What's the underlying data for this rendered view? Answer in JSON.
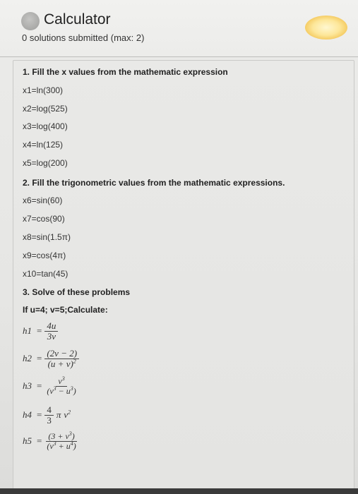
{
  "header": {
    "title": "Calculator",
    "submissions": "0 solutions submitted (max: 2)"
  },
  "q1": {
    "heading": "1. Fill the x values from the mathematic expression",
    "items": [
      "x1=ln(300)",
      "x2=log(525)",
      "x3=log(400)",
      "x4=ln(125)",
      "x5=log(200)"
    ]
  },
  "q2": {
    "heading": "2. Fill the trigonometric values from the mathematic expressions.",
    "items": [
      "x6=sin(60)",
      "x7=cos(90)",
      "x8=sin(1.5π)",
      "x9=cos(4π)",
      "x10=tan(45)"
    ]
  },
  "q3": {
    "heading": "3. Solve of these problems",
    "given": "If u=4; v=5;Calculate:",
    "h1": {
      "lhs": "h1",
      "num": "4u",
      "den": "3v"
    },
    "h2": {
      "lhs": "h2",
      "num": "(2v − 2)",
      "den_base": "(u + v)",
      "den_exp": "2"
    },
    "h3": {
      "lhs": "h3",
      "num_base": "v",
      "num_exp": "3",
      "den_a": "(v",
      "den_a_exp": "3",
      "den_b": " − u",
      "den_b_exp": "3",
      "den_c": ")"
    },
    "h4": {
      "lhs": "h4",
      "frac_num": "4",
      "frac_den": "3",
      "pi": "π",
      "v": "v",
      "v_exp": "2"
    },
    "h5": {
      "lhs": "h5",
      "num_a": "(3 + v",
      "num_a_exp": "3",
      "num_b": ")",
      "den_a": "(v",
      "den_a_exp": "3",
      "den_b": " + u",
      "den_b_exp": "4",
      "den_c": ")"
    }
  },
  "colors": {
    "background": "#e8e8e6",
    "text": "#333333",
    "icon": "#b0b0ae"
  }
}
